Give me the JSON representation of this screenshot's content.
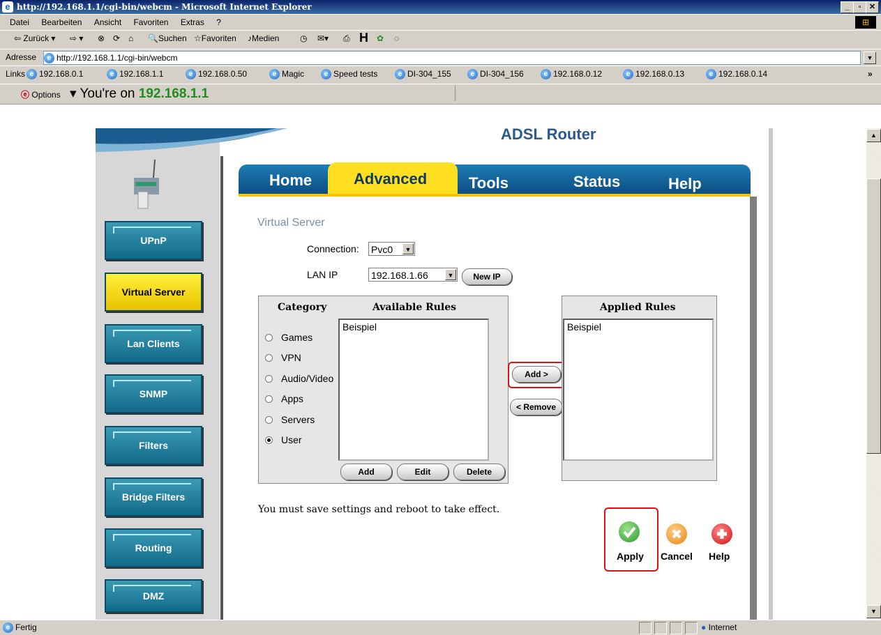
{
  "window": {
    "title": "http://192.168.1.1/cgi-bin/webcm - Microsoft Internet Explorer"
  },
  "menu": [
    "Datei",
    "Bearbeiten",
    "Ansicht",
    "Favoriten",
    "Extras",
    "?"
  ],
  "toolbar": {
    "back": "Zurück",
    "search": "Suchen",
    "favorites": "Favoriten",
    "media": "Medien"
  },
  "address": {
    "label": "Adresse",
    "url": "http://192.168.1.1/cgi-bin/webcm"
  },
  "links": {
    "label": "Links",
    "items": [
      "192.168.0.1",
      "192.168.1.1",
      "192.168.0.50",
      "Magic",
      "Speed tests",
      "DI-304_155",
      "DI-304_156",
      "192.168.0.12",
      "192.168.0.13",
      "192.168.0.14"
    ]
  },
  "infobar": {
    "options": "Options",
    "prefix": "You're on",
    "ip": "192.168.1.1"
  },
  "router": {
    "header": "ADSL Router"
  },
  "tabs": [
    "Home",
    "Advanced",
    "Tools",
    "Status",
    "Help"
  ],
  "sidebar": [
    "UPnP",
    "Virtual Server",
    "Lan Clients",
    "SNMP",
    "Filters",
    "Bridge Filters",
    "Routing",
    "DMZ"
  ],
  "vs": {
    "title": "Virtual Server",
    "connection_label": "Connection:",
    "connection_value": "Pvc0",
    "lanip_label": "LAN IP",
    "lanip_value": "192.168.1.66",
    "newip_button": "New IP",
    "category_header": "Category",
    "available_header": "Available Rules",
    "applied_header": "Applied Rules",
    "categories": [
      "Games",
      "VPN",
      "Audio/Video",
      "Apps",
      "Servers",
      "User"
    ],
    "selected_category": "User",
    "available_rules": [
      "Beispiel"
    ],
    "applied_rules": [
      "Beispiel"
    ],
    "add_button": "Add >",
    "remove_button": "< Remove",
    "list_add": "Add",
    "list_edit": "Edit",
    "list_delete": "Delete",
    "note": "You must save settings and reboot to take effect.",
    "apply": "Apply",
    "cancel": "Cancel",
    "help": "Help"
  },
  "status": {
    "left": "Fertig",
    "zone": "Internet"
  }
}
